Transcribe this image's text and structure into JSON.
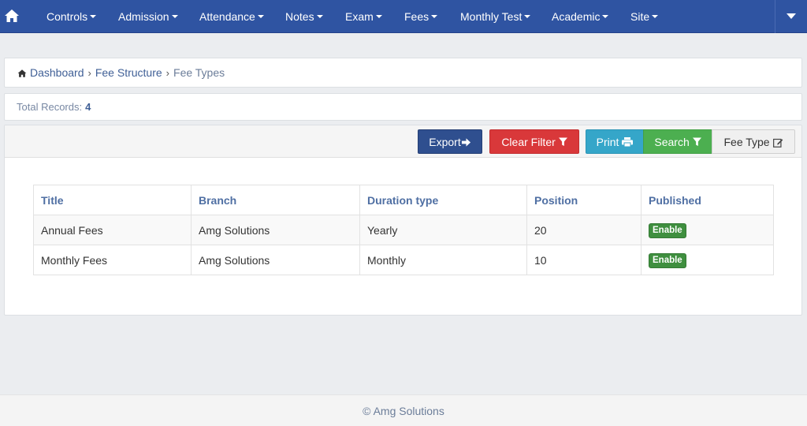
{
  "nav": {
    "items": [
      {
        "label": "Controls"
      },
      {
        "label": "Admission"
      },
      {
        "label": "Attendance"
      },
      {
        "label": "Notes"
      },
      {
        "label": "Exam"
      },
      {
        "label": "Fees"
      },
      {
        "label": "Monthly Test"
      },
      {
        "label": "Academic"
      },
      {
        "label": "Site"
      }
    ]
  },
  "breadcrumb": {
    "items": [
      "Dashboard",
      "Fee Structure",
      "Fee Types"
    ],
    "separator": "›"
  },
  "records": {
    "label": "Total Records:",
    "count": "4"
  },
  "toolbar": {
    "export_label": "Export",
    "clear_filter_label": "Clear Filter",
    "print_label": "Print",
    "search_label": "Search",
    "fee_type_label": "Fee Type"
  },
  "table": {
    "headers": [
      "Title",
      "Branch",
      "Duration type",
      "Position",
      "Published"
    ],
    "rows": [
      {
        "title": "Annual Fees",
        "branch": "Amg Solutions",
        "duration": "Yearly",
        "position": "20",
        "published": "Enable"
      },
      {
        "title": "Monthly Fees",
        "branch": "Amg Solutions",
        "duration": "Monthly",
        "position": "10",
        "published": "Enable"
      }
    ]
  },
  "footer": {
    "text": "© Amg Solutions"
  },
  "colors": {
    "navbar": "#2f54a2",
    "export": "#2f4f8f",
    "clear_filter": "#d9383a",
    "print": "#35a6c9",
    "search": "#4caf50",
    "badge": "#3f8f3f"
  },
  "icons": {
    "home": "home-icon",
    "export": "arrow-right-icon",
    "filter": "filter-icon",
    "print": "printer-icon",
    "edit": "edit-icon",
    "dropdown": "caret-down-icon"
  }
}
